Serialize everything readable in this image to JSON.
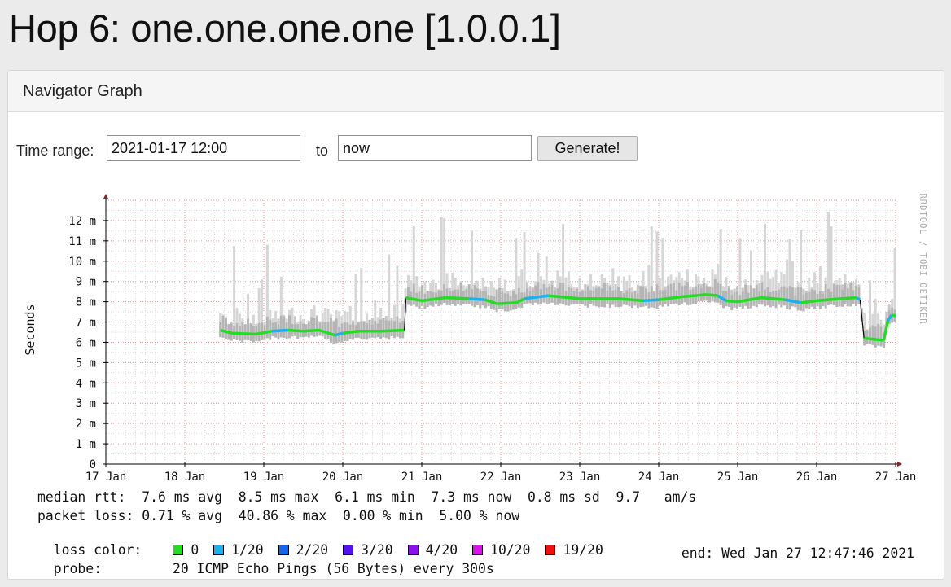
{
  "page": {
    "title": "Hop 6: one.one.one.one [1.0.0.1]"
  },
  "panel": {
    "title": "Navigator Graph"
  },
  "form": {
    "time_range_label": "Time range:",
    "start_value": "2021-01-17 12:00",
    "to_label": "to",
    "end_value": "now",
    "generate_label": "Generate!"
  },
  "chart_data": {
    "type": "area",
    "ylabel": "Seconds",
    "watermark": "RRDTOOL / TOBI OETIKER",
    "y_ticks": [
      "0",
      "1 m",
      "2 m",
      "3 m",
      "4 m",
      "5 m",
      "6 m",
      "7 m",
      "8 m",
      "9 m",
      "10 m",
      "11 m",
      "12 m"
    ],
    "x_ticks": [
      "17 Jan",
      "18 Jan",
      "19 Jan",
      "20 Jan",
      "21 Jan",
      "22 Jan",
      "23 Jan",
      "24 Jan",
      "25 Jan",
      "26 Jan",
      "27 Jan"
    ],
    "xlim_days": [
      17.0,
      27.0
    ],
    "ylim_ms": [
      0,
      13
    ],
    "grid": true,
    "median_series": {
      "name": "median rtt",
      "points": [
        [
          18.45,
          6.6
        ],
        [
          18.6,
          6.45
        ],
        [
          18.9,
          6.4
        ],
        [
          19.1,
          6.55
        ],
        [
          19.3,
          6.6
        ],
        [
          19.5,
          6.55
        ],
        [
          19.7,
          6.6
        ],
        [
          19.9,
          6.35
        ],
        [
          20.0,
          6.45
        ],
        [
          20.2,
          6.55
        ],
        [
          20.5,
          6.55
        ],
        [
          20.78,
          6.6
        ],
        [
          20.8,
          8.2
        ],
        [
          21.0,
          8.05
        ],
        [
          21.3,
          8.2
        ],
        [
          21.6,
          8.15
        ],
        [
          21.8,
          8.1
        ],
        [
          21.95,
          7.9
        ],
        [
          22.2,
          7.95
        ],
        [
          22.3,
          8.15
        ],
        [
          22.6,
          8.3
        ],
        [
          23.0,
          8.15
        ],
        [
          23.5,
          8.15
        ],
        [
          23.8,
          8.05
        ],
        [
          24.0,
          8.1
        ],
        [
          24.3,
          8.25
        ],
        [
          24.6,
          8.35
        ],
        [
          24.75,
          8.3
        ],
        [
          24.85,
          8.05
        ],
        [
          25.0,
          8.0
        ],
        [
          25.3,
          8.2
        ],
        [
          25.6,
          8.1
        ],
        [
          25.8,
          7.95
        ],
        [
          26.0,
          8.05
        ],
        [
          26.3,
          8.15
        ],
        [
          26.5,
          8.2
        ],
        [
          26.55,
          8.1
        ],
        [
          26.6,
          6.2
        ],
        [
          26.85,
          6.1
        ],
        [
          26.9,
          7.05
        ],
        [
          26.95,
          7.35
        ],
        [
          27.0,
          7.3
        ]
      ]
    }
  },
  "legend": {
    "median_rtt": "median rtt:  7.6 ms avg  8.5 ms max  6.1 ms min  7.3 ms now  0.8 ms sd  9.7   am/s",
    "packet_loss": "packet loss: 0.71 % avg  40.86 % max  0.00 % min  5.00 % now",
    "loss_color_label": "loss color:",
    "loss_colors": [
      {
        "label": "0",
        "color": "#22dd22"
      },
      {
        "label": "1/20",
        "color": "#1ab2ee"
      },
      {
        "label": "2/20",
        "color": "#1366ee"
      },
      {
        "label": "3/20",
        "color": "#5511ee"
      },
      {
        "label": "4/20",
        "color": "#8811ee"
      },
      {
        "label": "10/20",
        "color": "#dd11ee"
      },
      {
        "label": "19/20",
        "color": "#ee1111"
      }
    ],
    "probe_label": "probe:",
    "probe_text": "20 ICMP Echo Pings (56 Bytes) every 300s",
    "end_text": "end: Wed Jan 27 12:47:46 2021"
  }
}
